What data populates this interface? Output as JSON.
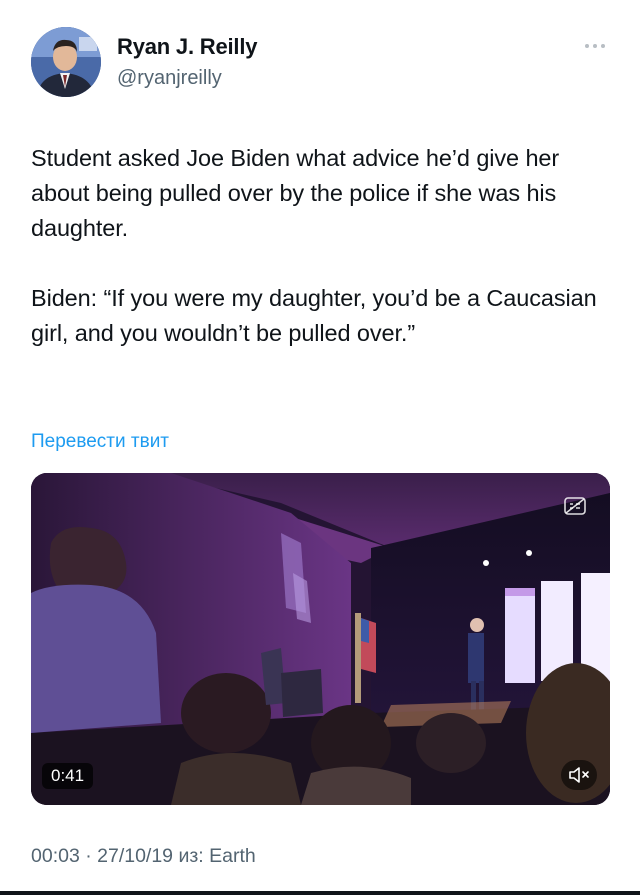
{
  "author": {
    "name": "Ryan J. Reilly",
    "handle": "@ryanjreilly"
  },
  "tweet": {
    "paragraphs": [
      "Student asked Joe Biden what advice he’d give her about being pulled over by the police if she was his daughter.",
      "Biden: “If you were my daughter, you’d be a Caucasian girl, and you wouldn’t be pulled over.”"
    ],
    "translate_link": "Перевести твит"
  },
  "media": {
    "type": "video",
    "duration": "0:41",
    "icons": {
      "gif_badge": "captions-icon",
      "mute": "volume-muted-icon"
    }
  },
  "meta": {
    "timestamp": "00:03 · 27/10/19 из: Earth"
  },
  "colors": {
    "link": "#1d9bf0",
    "secondary_text": "#536471",
    "primary_text": "#0f1419"
  }
}
